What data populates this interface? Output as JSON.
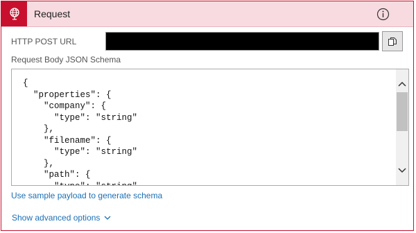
{
  "header": {
    "title": "Request",
    "icon": "globe-request-icon",
    "info_icon": "info-icon",
    "accent": "#c8102e",
    "background": "#f7dbe0"
  },
  "url_section": {
    "label": "HTTP POST URL",
    "value_redacted": true,
    "copy_icon": "copy-icon"
  },
  "schema_section": {
    "label": "Request Body JSON Schema",
    "lines": [
      "{",
      "  \"properties\": {",
      "    \"company\": {",
      "      \"type\": \"string\"",
      "    },",
      "    \"filename\": {",
      "      \"type\": \"string\"",
      "    },",
      "    \"path\": {",
      "      \"type\": \"string\"",
      "    }"
    ]
  },
  "links": {
    "sample_payload": "Use sample payload to generate schema",
    "advanced": "Show advanced options"
  }
}
